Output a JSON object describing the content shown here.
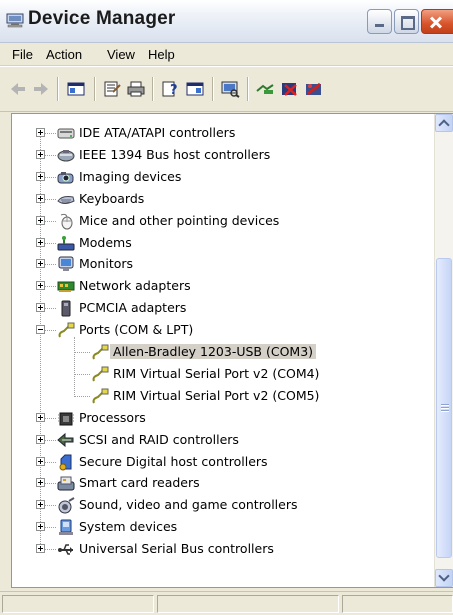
{
  "window": {
    "title": "Device Manager"
  },
  "menu": [
    "File",
    "Action",
    "View",
    "Help"
  ],
  "toolbar": {
    "buttons": [
      "back-icon",
      "forward-icon",
      "show-hide-console-tree-icon",
      "properties-icon",
      "print-icon",
      "help-icon",
      "show-hide-action-pane-icon",
      "scan-hardware-changes-icon",
      "update-driver-icon",
      "uninstall-icon",
      "disable-icon"
    ]
  },
  "tree": {
    "items": [
      {
        "label": "IDE ATA/ATAPI controllers",
        "icon": "ide-controller-icon",
        "level": 0,
        "expander": "plus"
      },
      {
        "label": "IEEE 1394 Bus host controllers",
        "icon": "firewire-icon",
        "level": 0,
        "expander": "plus"
      },
      {
        "label": "Imaging devices",
        "icon": "camera-icon",
        "level": 0,
        "expander": "plus"
      },
      {
        "label": "Keyboards",
        "icon": "keyboard-icon",
        "level": 0,
        "expander": "plus"
      },
      {
        "label": "Mice and other pointing devices",
        "icon": "mouse-icon",
        "level": 0,
        "expander": "plus"
      },
      {
        "label": "Modems",
        "icon": "modem-icon",
        "level": 0,
        "expander": "plus"
      },
      {
        "label": "Monitors",
        "icon": "monitor-icon",
        "level": 0,
        "expander": "plus"
      },
      {
        "label": "Network adapters",
        "icon": "network-card-icon",
        "level": 0,
        "expander": "plus"
      },
      {
        "label": "PCMCIA adapters",
        "icon": "pcmcia-icon",
        "level": 0,
        "expander": "plus"
      },
      {
        "label": "Ports (COM & LPT)",
        "icon": "port-connector-icon",
        "level": 0,
        "expander": "minus"
      },
      {
        "label": "Allen-Bradley 1203-USB (COM3)",
        "icon": "port-connector-icon",
        "level": 1,
        "selected": true
      },
      {
        "label": "RIM Virtual Serial Port v2 (COM4)",
        "icon": "port-connector-icon",
        "level": 1
      },
      {
        "label": "RIM Virtual Serial Port v2 (COM5)",
        "icon": "port-connector-icon",
        "level": 1
      },
      {
        "label": "Processors",
        "icon": "processor-icon",
        "level": 0,
        "expander": "plus"
      },
      {
        "label": "SCSI and RAID controllers",
        "icon": "scsi-icon",
        "level": 0,
        "expander": "plus"
      },
      {
        "label": "Secure Digital host controllers",
        "icon": "sd-card-icon",
        "level": 0,
        "expander": "plus"
      },
      {
        "label": "Smart card readers",
        "icon": "smart-card-reader-icon",
        "level": 0,
        "expander": "plus"
      },
      {
        "label": "Sound, video and game controllers",
        "icon": "sound-icon",
        "level": 0,
        "expander": "plus"
      },
      {
        "label": "System devices",
        "icon": "system-devices-icon",
        "level": 0,
        "expander": "plus"
      },
      {
        "label": "Universal Serial Bus controllers",
        "icon": "usb-icon",
        "level": 0,
        "expander": "plus"
      }
    ]
  },
  "colors": {
    "selection": "#d4d0c8",
    "pane_border": "#7f9db9",
    "chrome": "#ece9d8"
  }
}
